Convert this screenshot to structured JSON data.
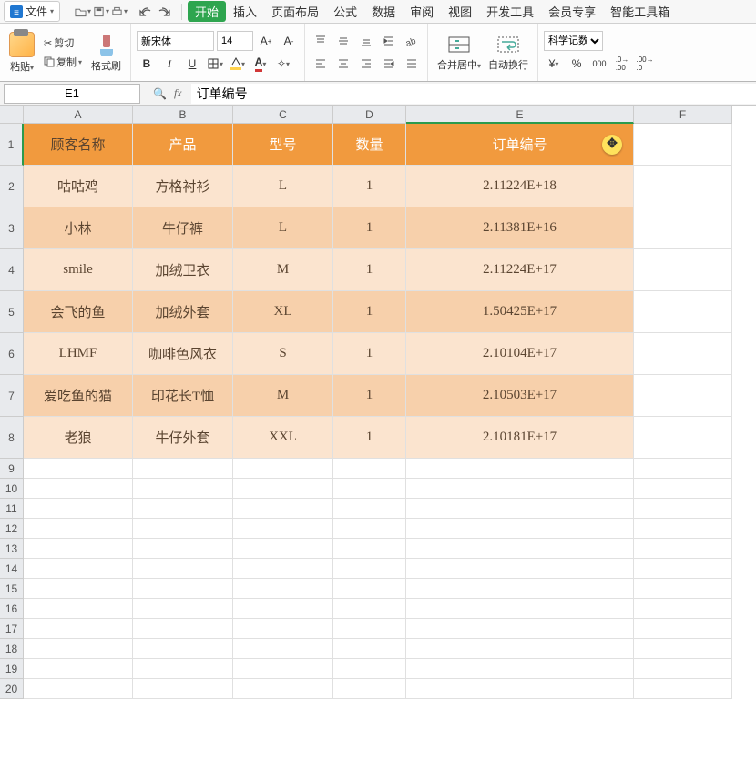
{
  "menu": {
    "file_label": "文件",
    "tabs": [
      "开始",
      "插入",
      "页面布局",
      "公式",
      "数据",
      "审阅",
      "视图",
      "开发工具",
      "会员专享",
      "智能工具箱"
    ],
    "active_tab": 0
  },
  "ribbon": {
    "paste_label": "粘贴",
    "cut_label": "剪切",
    "copy_label": "复制",
    "format_painter_label": "格式刷",
    "font_name": "新宋体",
    "font_size": "14",
    "merge_label": "合并居中",
    "wrap_label": "自动换行",
    "num_format": "科学记数",
    "bold": "B",
    "italic": "I",
    "underline": "U"
  },
  "formula_bar": {
    "name_box": "E1",
    "formula": "订单编号"
  },
  "sheet": {
    "col_letters": [
      "A",
      "B",
      "C",
      "D",
      "E",
      "F"
    ],
    "headers": [
      "顾客名称",
      "产品",
      "型号",
      "数量",
      "订单编号"
    ],
    "rows": [
      {
        "n": "2",
        "a": "咕咕鸡",
        "b": "方格衬衫",
        "c": "L",
        "d": "1",
        "e": "2.11224E+18",
        "cls": "light"
      },
      {
        "n": "3",
        "a": "小林",
        "b": "牛仔裤",
        "c": "L",
        "d": "1",
        "e": "2.11381E+16",
        "cls": "dark"
      },
      {
        "n": "4",
        "a": "smile",
        "b": "加绒卫衣",
        "c": "M",
        "d": "1",
        "e": "2.11224E+17",
        "cls": "light"
      },
      {
        "n": "5",
        "a": "会飞的鱼",
        "b": "加绒外套",
        "c": "XL",
        "d": "1",
        "e": "1.50425E+17",
        "cls": "dark"
      },
      {
        "n": "6",
        "a": "LHMF",
        "b": "咖啡色风衣",
        "c": "S",
        "d": "1",
        "e": "2.10104E+17",
        "cls": "light"
      },
      {
        "n": "7",
        "a": "爱吃鱼的猫",
        "b": "印花长T恤",
        "c": "M",
        "d": "1",
        "e": "2.10503E+17",
        "cls": "dark"
      },
      {
        "n": "8",
        "a": "老狼",
        "b": "牛仔外套",
        "c": "XXL",
        "d": "1",
        "e": "2.10181E+17",
        "cls": "light"
      }
    ],
    "blank_rows": [
      "9",
      "10",
      "11",
      "12",
      "13",
      "14",
      "15",
      "16",
      "17",
      "18",
      "19",
      "20"
    ]
  }
}
